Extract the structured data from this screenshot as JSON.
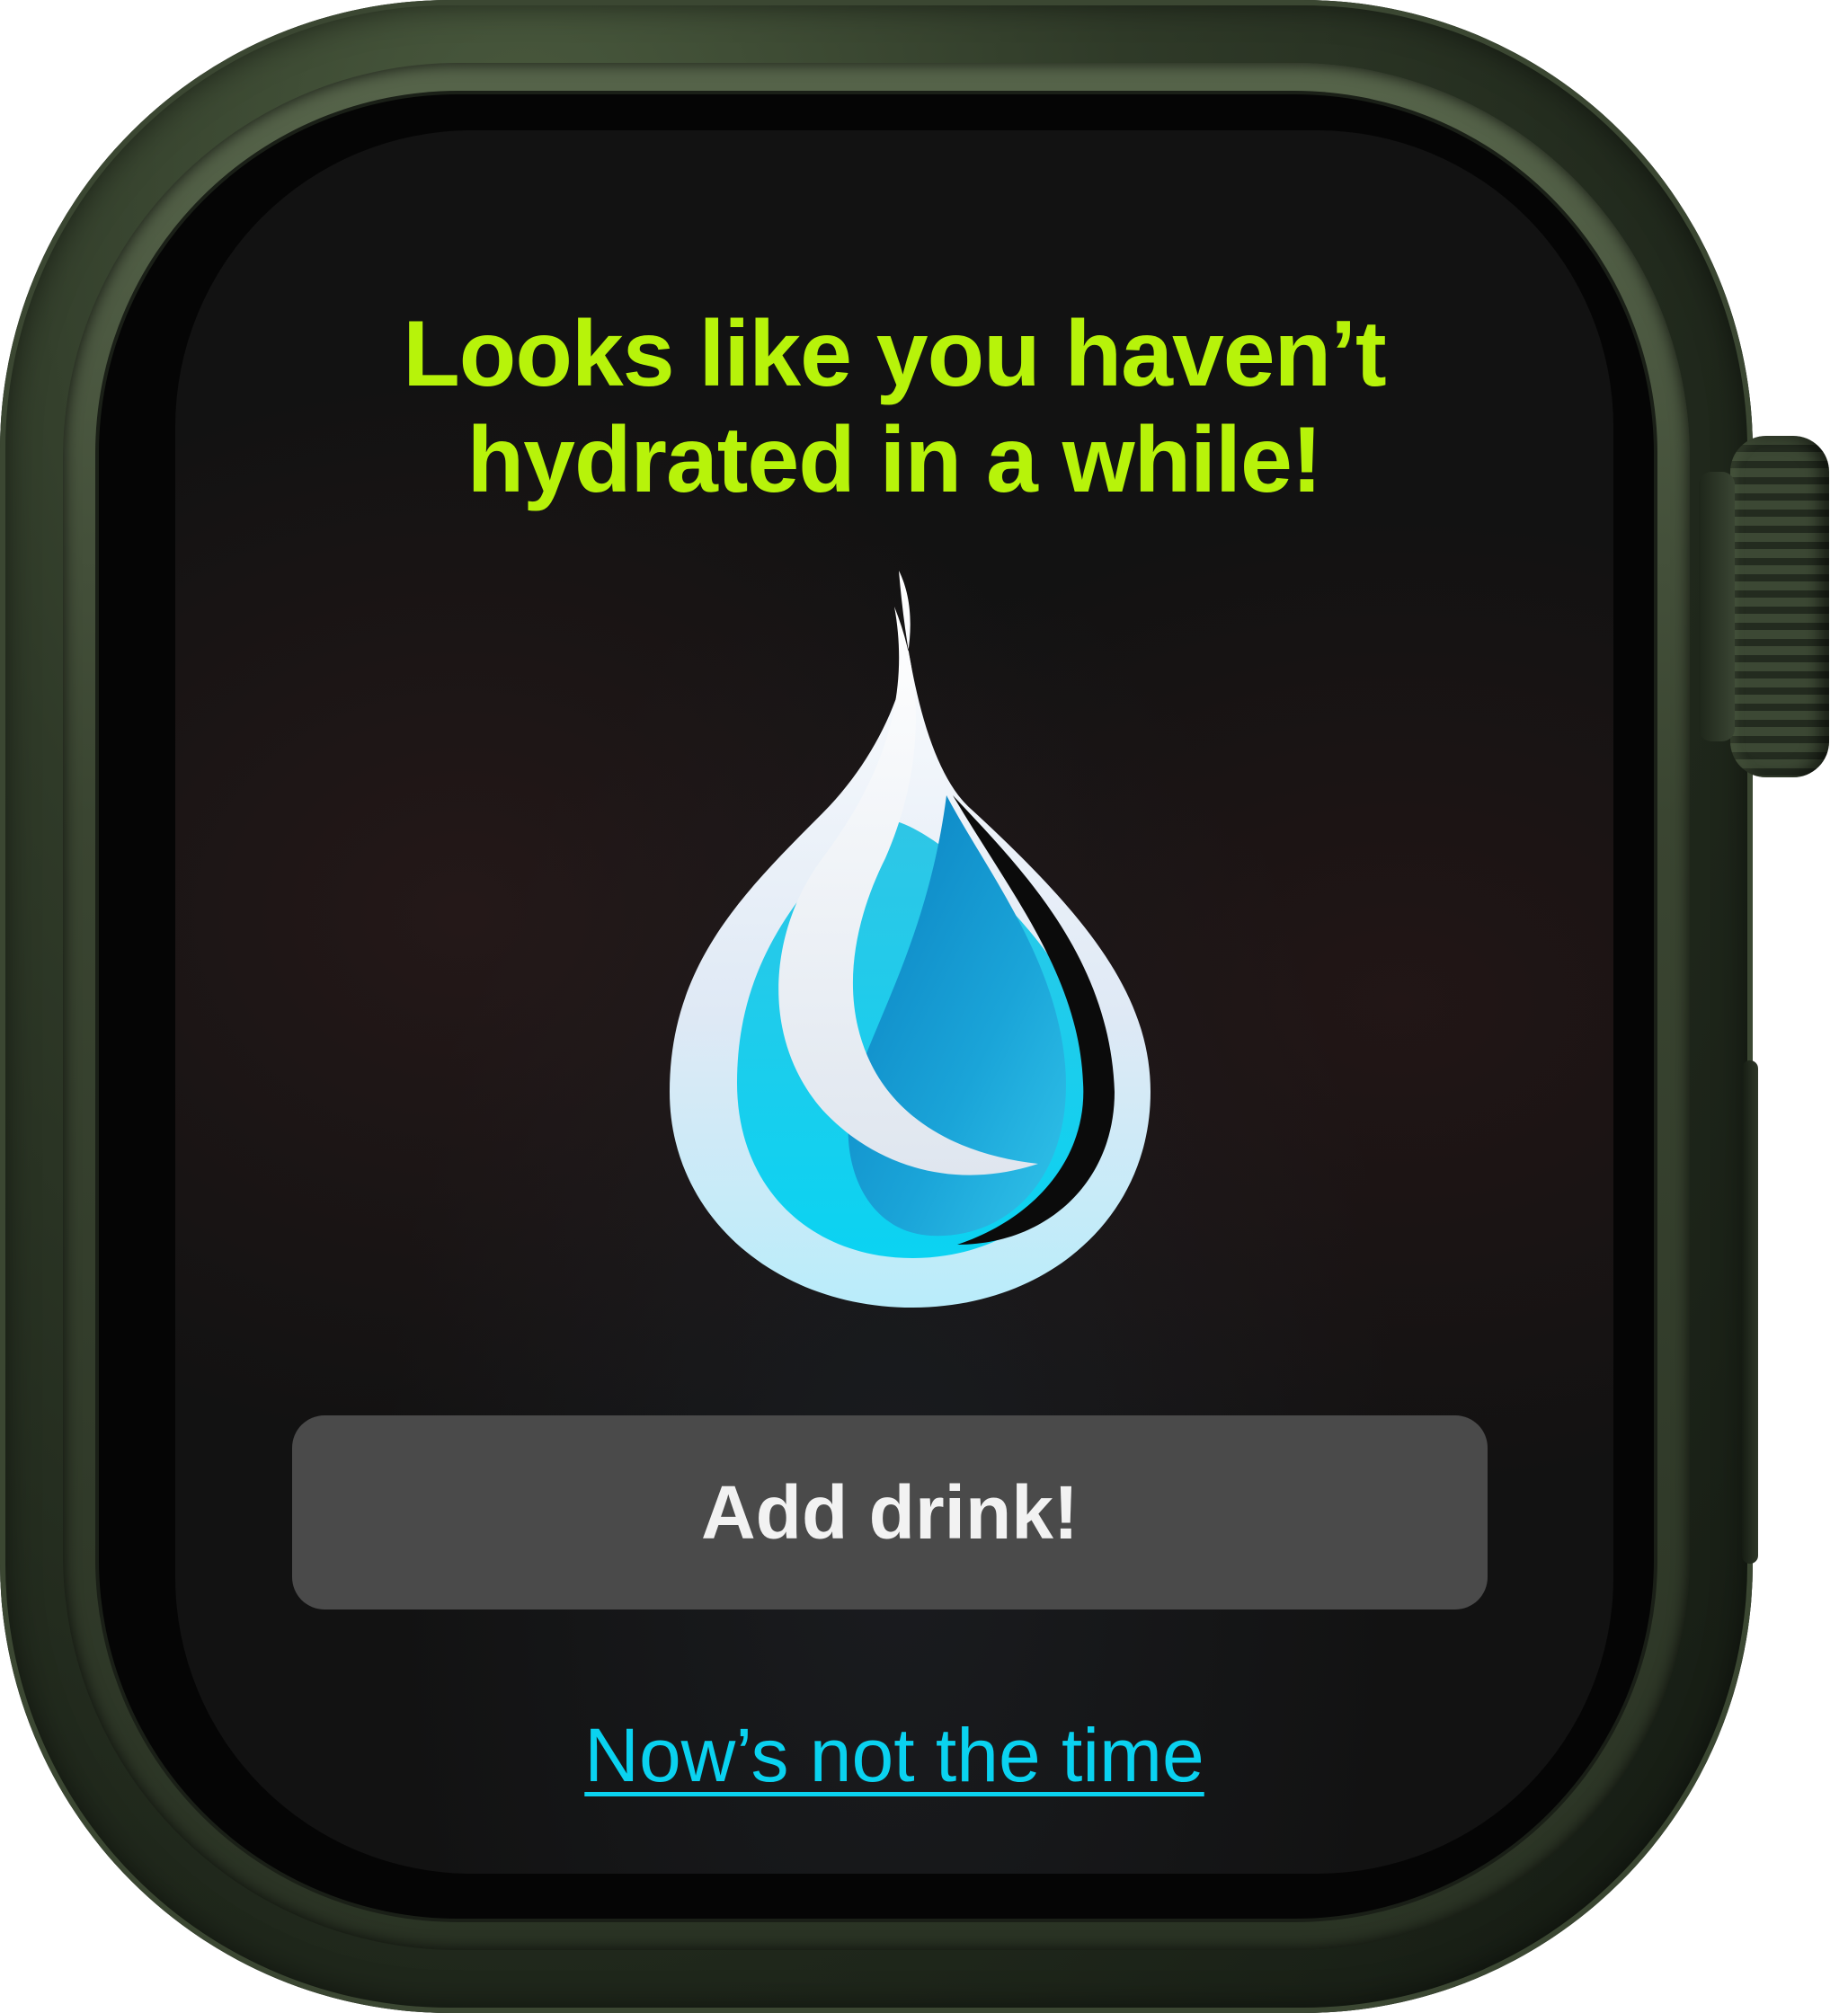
{
  "notification": {
    "headline_line_1": "Looks like you haven’t",
    "headline_line_2": "hydrated in a while!",
    "icon": "water-drop-icon",
    "primary_action_label": "Add drink!",
    "secondary_action_label": "Now’s not the time"
  },
  "colors": {
    "headline": "#b7f30a",
    "link": "#0ad2f0",
    "button_background": "#4a4a4a",
    "button_text": "#f2f2f2",
    "screen_background": "#121212",
    "case": "#2f3a28"
  }
}
